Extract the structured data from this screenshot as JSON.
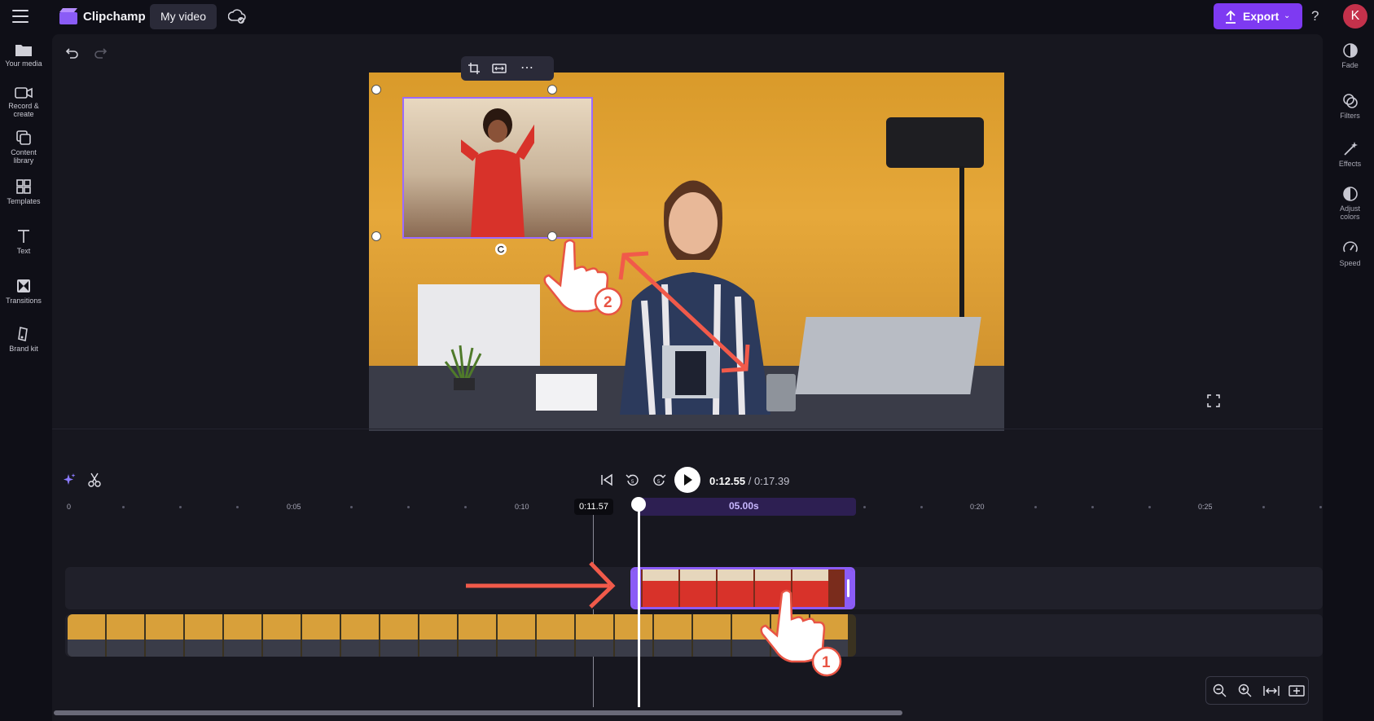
{
  "app": {
    "name": "Clipchamp",
    "project_title": "My video"
  },
  "header": {
    "export_label": "Export",
    "help_label": "?",
    "avatar_initial": "K"
  },
  "left_nav": [
    {
      "label": "Your media",
      "icon": "folder-icon"
    },
    {
      "label": "Record &",
      "label2": "create",
      "icon": "camera-icon"
    },
    {
      "label": "Content",
      "label2": "library",
      "icon": "library-icon"
    },
    {
      "label": "Templates",
      "icon": "templates-icon"
    },
    {
      "label": "Text",
      "icon": "text-icon"
    },
    {
      "label": "Transitions",
      "icon": "transitions-icon"
    },
    {
      "label": "Brand kit",
      "icon": "brand-kit-icon"
    }
  ],
  "right_nav": [
    {
      "label": "Fade",
      "icon": "fade-icon"
    },
    {
      "label": "Filters",
      "icon": "filters-icon"
    },
    {
      "label": "Effects",
      "icon": "effects-icon"
    },
    {
      "label": "Adjust",
      "label2": "colors",
      "icon": "adjust-colors-icon"
    },
    {
      "label": "Speed",
      "icon": "speed-icon"
    }
  ],
  "playback": {
    "current_time": "0:12.55",
    "separator": " / ",
    "total_time": "0:17.39"
  },
  "ruler": {
    "labels": [
      "0",
      "0:05",
      "0:10",
      "0:20",
      "0:25"
    ]
  },
  "timeline": {
    "hover_time": "0:11.57",
    "clip_duration": "05.00s"
  },
  "annotations": {
    "step1": "1",
    "step2": "2"
  },
  "colors": {
    "accent": "#7e3af2",
    "clip_border": "#8b5cf6",
    "arrow": "#f15a4a"
  }
}
